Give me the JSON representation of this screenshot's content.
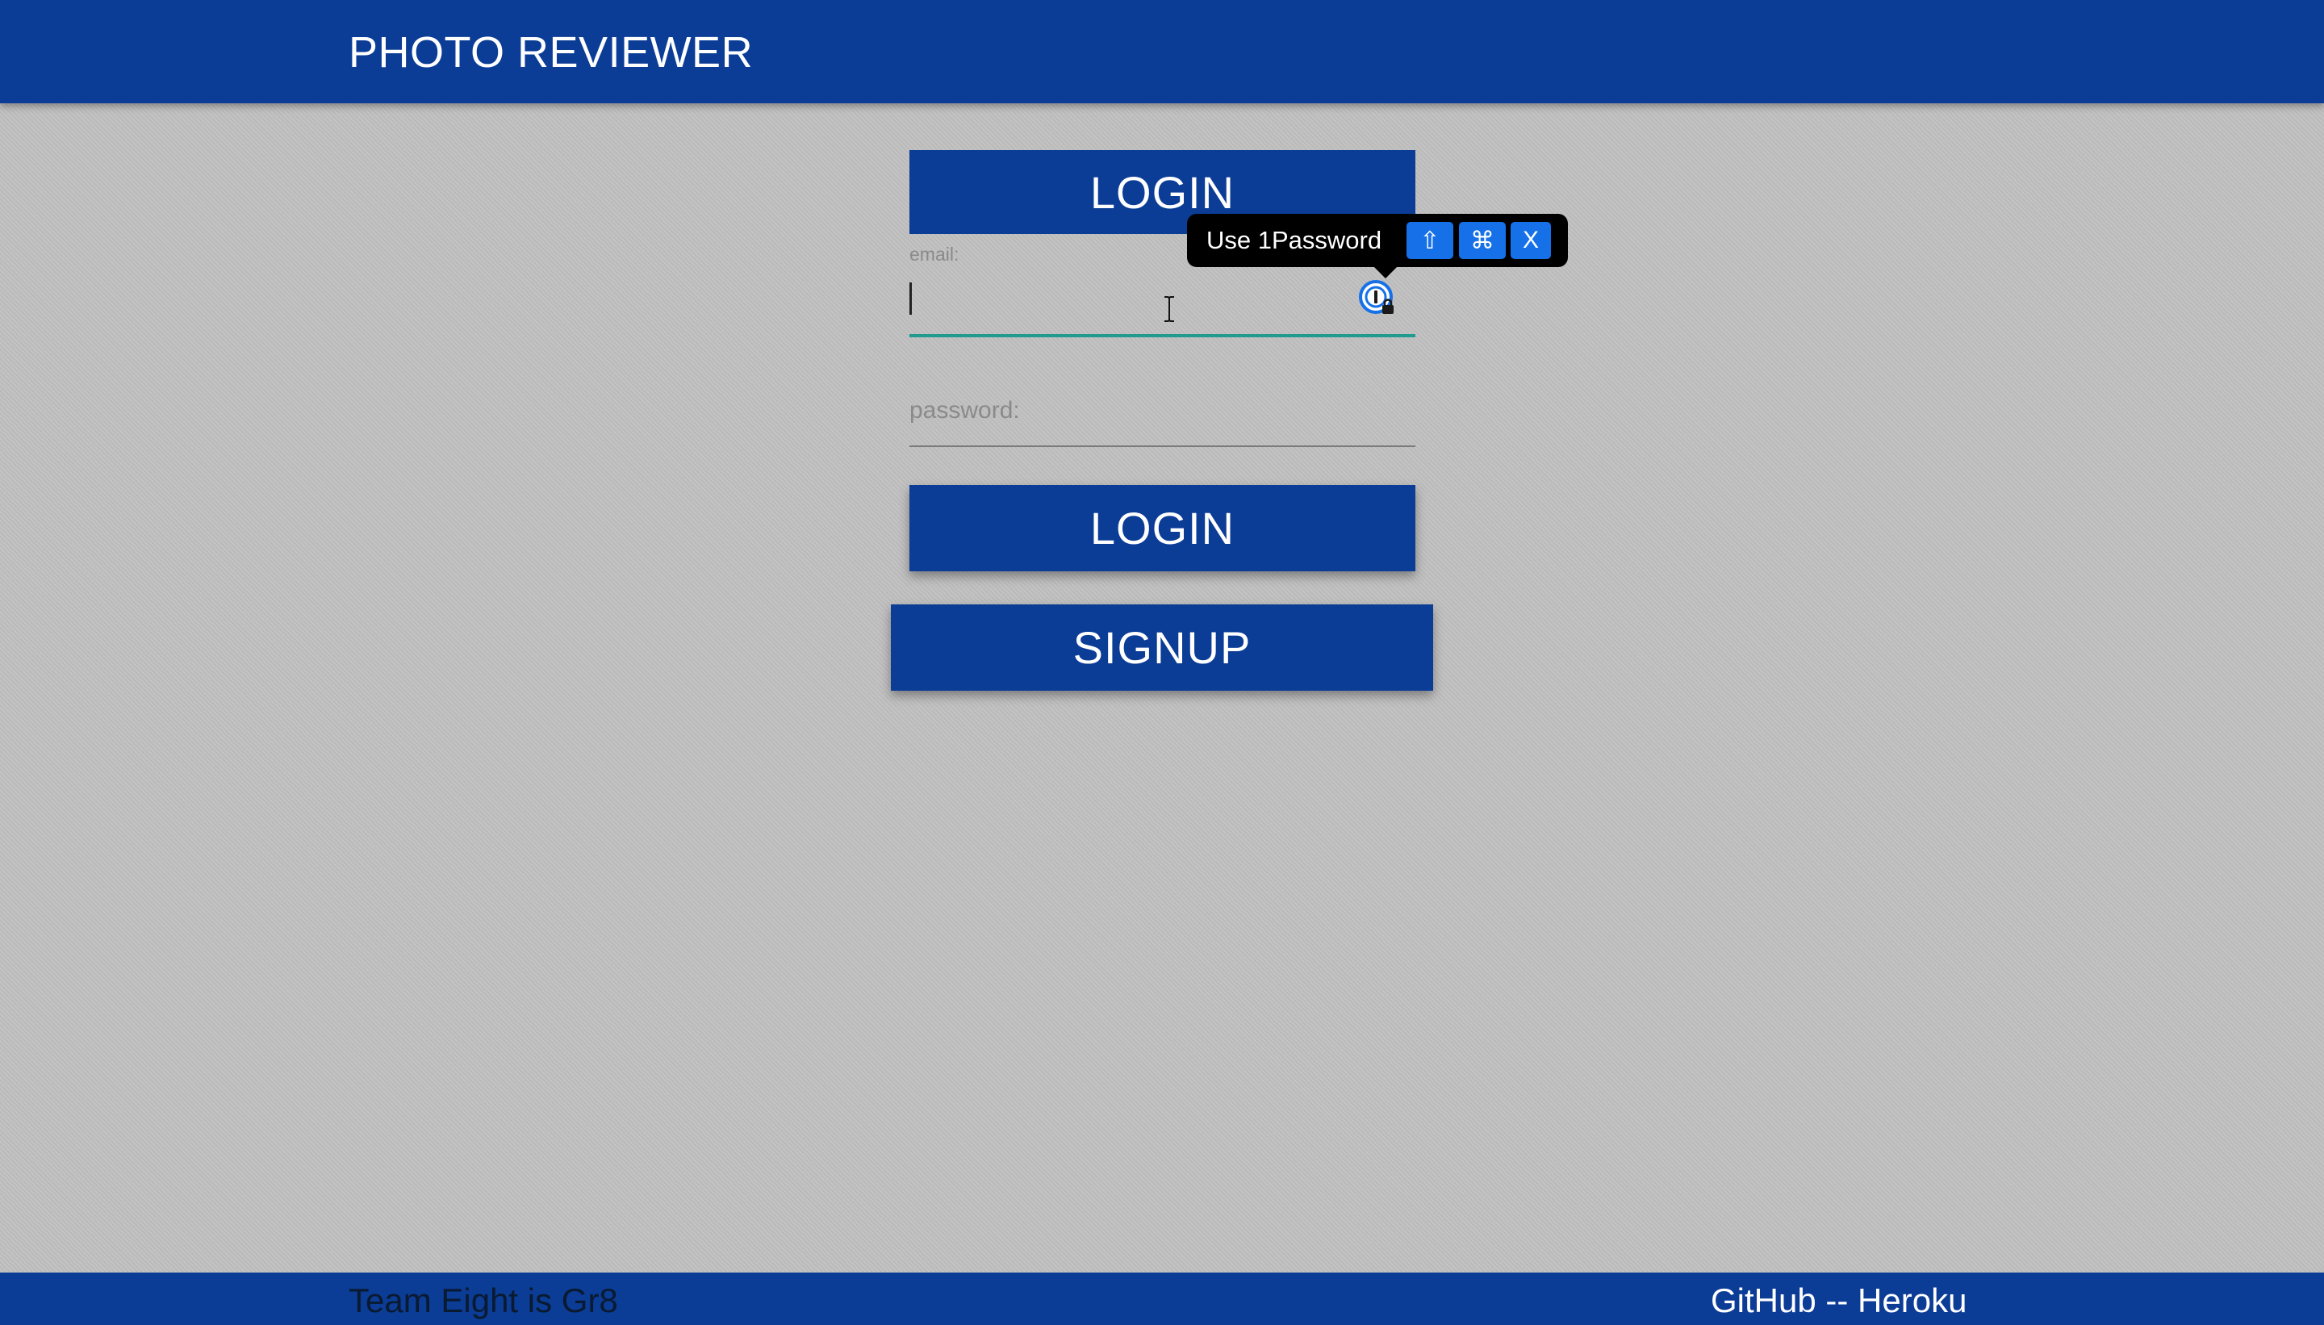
{
  "header": {
    "title": "PHOTO REVIEWER"
  },
  "form": {
    "heading": "LOGIN",
    "email_label": "email:",
    "email_value": "",
    "password_placeholder": "password:",
    "login_button": "LOGIN",
    "signup_button": "SIGNUP"
  },
  "onepassword": {
    "text": "Use 1Password",
    "shift_key": "⇧",
    "cmd_key": "⌘",
    "close_key": "X"
  },
  "footer": {
    "left_text": "Team Eight is Gr8",
    "github": "GitHub",
    "separator": " -- ",
    "heroku": "Heroku"
  },
  "colors": {
    "primary": "#0b3c96",
    "background": "#c0c0c0",
    "input_focus_underline": "#1f9c8f",
    "onepassword_blue": "#1671e8"
  }
}
